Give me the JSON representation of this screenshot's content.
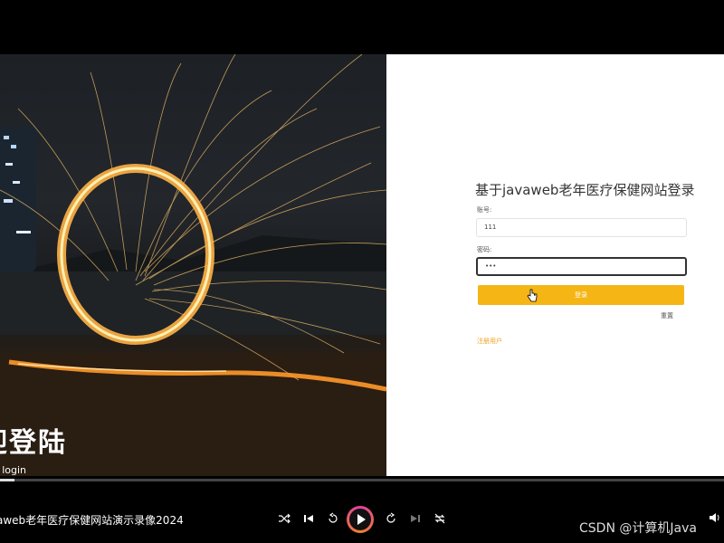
{
  "photo": {
    "welcome_title": "迎登陆",
    "welcome_sub": "o login"
  },
  "form": {
    "title": "基于javaweb老年医疗保健网站登录",
    "username_label": "账号:",
    "username_value": "111",
    "password_label": "密码:",
    "password_value": "•••",
    "login_button": "登录",
    "reset_link": "重置",
    "register_link": "注册用户",
    "accent_color": "#f5b515"
  },
  "player": {
    "video_title": "aweb老年医疗保健网站演示录像2024",
    "progress": 0.02,
    "watermark": "CSDN @计算机Java",
    "controls": [
      "shuffle-icon",
      "skip-previous-icon",
      "rewind-icon",
      "play-icon",
      "fast-forward-icon",
      "skip-next-icon",
      "repeat-off-icon",
      "volume-icon"
    ]
  }
}
